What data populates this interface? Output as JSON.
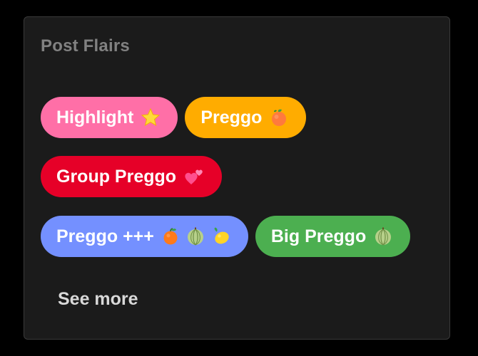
{
  "widget": {
    "title": "Post Flairs",
    "see_more_label": "See more"
  },
  "flairs": [
    {
      "label": "Highlight",
      "color": "#ff6fa7",
      "emojis": [
        "star-icon"
      ]
    },
    {
      "label": "Preggo",
      "color": "#ffac00",
      "emojis": [
        "peach-icon"
      ]
    },
    {
      "label": "Group Preggo",
      "color": "#e60028",
      "emojis": [
        "two-hearts-icon"
      ]
    },
    {
      "label": "Preggo +++",
      "color": "#7490ff",
      "emojis": [
        "tangerine-icon",
        "melon-icon",
        "lemon-icon"
      ]
    },
    {
      "label": "Big Preggo",
      "color": "#4caf50",
      "emojis": [
        "melon-icon"
      ]
    }
  ]
}
